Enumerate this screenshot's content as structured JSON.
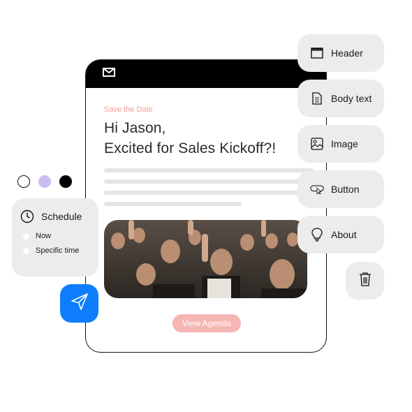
{
  "email": {
    "eyebrow": "Save the Date",
    "greeting_line1": "Hi Jason,",
    "greeting_line2": "Excited for Sales Kickoff?!",
    "cta": "View Agenda",
    "hero_image": "crowd-photo"
  },
  "palette": {
    "items": [
      {
        "label": "Header",
        "icon": "header-icon"
      },
      {
        "label": "Body text",
        "icon": "document-icon"
      },
      {
        "label": "Image",
        "icon": "image-icon"
      },
      {
        "label": "Button",
        "icon": "button-cursor-icon"
      },
      {
        "label": "About",
        "icon": "lightbulb-icon"
      }
    ],
    "trash_icon": "trash-icon"
  },
  "swatches": {
    "colors": [
      "#ffffff",
      "#cbbcf6",
      "#000000"
    ]
  },
  "schedule": {
    "title": "Schedule",
    "options": [
      "Now",
      "Specific time"
    ]
  },
  "colors": {
    "accent": "#0d7dfb",
    "cta": "#f6b6b4",
    "eyebrow": "#f29a99",
    "panel": "#ececec"
  }
}
